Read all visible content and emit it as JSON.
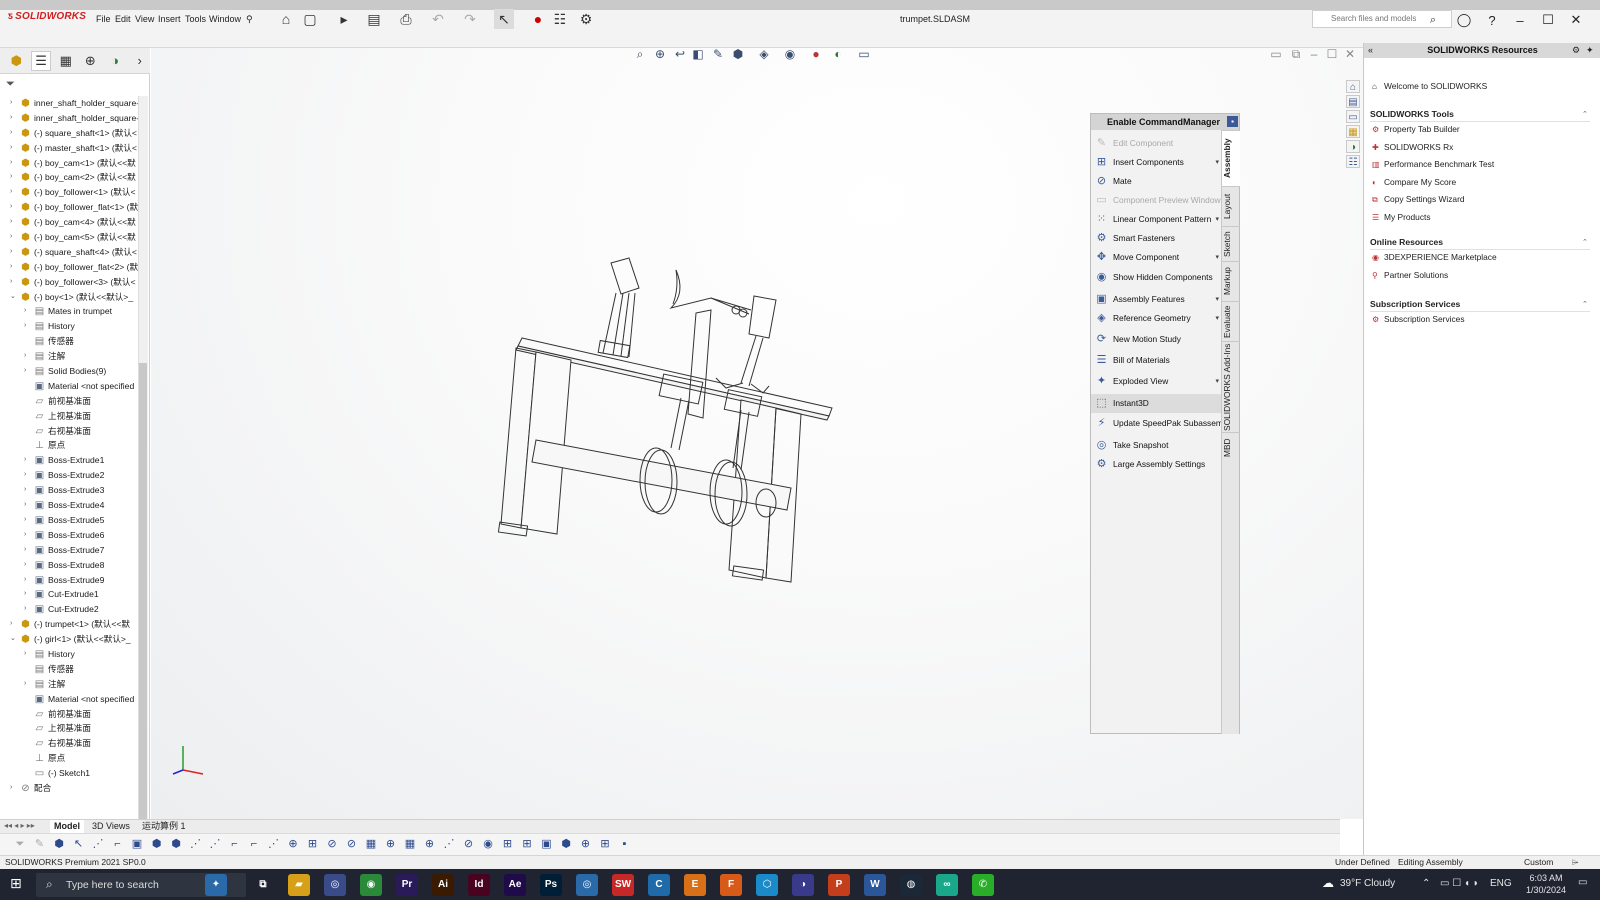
{
  "app": {
    "name": "SOLIDWORKS",
    "doc_title": "trumpet.SLDASM"
  },
  "menu": [
    "File",
    "Edit",
    "View",
    "Insert",
    "Tools",
    "Window"
  ],
  "search": {
    "placeholder": "Search files and models"
  },
  "tree": [
    {
      "depth": 0,
      "arrow": "›",
      "icon": "part",
      "label": "inner_shaft_holder_square-"
    },
    {
      "depth": 0,
      "arrow": "›",
      "icon": "part",
      "label": "inner_shaft_holder_square-"
    },
    {
      "depth": 0,
      "arrow": "›",
      "icon": "part",
      "label": "(-) square_shaft<1> (默认<"
    },
    {
      "depth": 0,
      "arrow": "›",
      "icon": "part",
      "label": "(-) master_shaft<1> (默认<"
    },
    {
      "depth": 0,
      "arrow": "›",
      "icon": "part",
      "label": "(-) boy_cam<1> (默认<<默"
    },
    {
      "depth": 0,
      "arrow": "›",
      "icon": "part",
      "label": "(-) boy_cam<2> (默认<<默"
    },
    {
      "depth": 0,
      "arrow": "›",
      "icon": "part",
      "label": "(-) boy_follower<1> (默认<"
    },
    {
      "depth": 0,
      "arrow": "›",
      "icon": "part",
      "label": "(-) boy_follower_flat<1> (默"
    },
    {
      "depth": 0,
      "arrow": "›",
      "icon": "part",
      "label": "(-) boy_cam<4> (默认<<默"
    },
    {
      "depth": 0,
      "arrow": "›",
      "icon": "part",
      "label": "(-) boy_cam<5> (默认<<默"
    },
    {
      "depth": 0,
      "arrow": "›",
      "icon": "part",
      "label": "(-) square_shaft<4> (默认<"
    },
    {
      "depth": 0,
      "arrow": "›",
      "icon": "part",
      "label": "(-) boy_follower_flat<2> (默"
    },
    {
      "depth": 0,
      "arrow": "›",
      "icon": "part",
      "label": "(-) boy_follower<3> (默认<"
    },
    {
      "depth": 0,
      "arrow": "⌄",
      "icon": "part",
      "label": "(-) boy<1> (默认<<默认>_"
    },
    {
      "depth": 1,
      "arrow": "›",
      "icon": "folder",
      "label": "Mates in trumpet"
    },
    {
      "depth": 1,
      "arrow": "›",
      "icon": "folder",
      "label": "History"
    },
    {
      "depth": 1,
      "arrow": "",
      "icon": "folder",
      "label": "传感器"
    },
    {
      "depth": 1,
      "arrow": "›",
      "icon": "folder",
      "label": "注解"
    },
    {
      "depth": 1,
      "arrow": "›",
      "icon": "folder",
      "label": "Solid Bodies(9)"
    },
    {
      "depth": 1,
      "arrow": "",
      "icon": "feat",
      "label": "Material <not specified"
    },
    {
      "depth": 1,
      "arrow": "",
      "icon": "plane",
      "label": "前视基准面"
    },
    {
      "depth": 1,
      "arrow": "",
      "icon": "plane",
      "label": "上视基准面"
    },
    {
      "depth": 1,
      "arrow": "",
      "icon": "plane",
      "label": "右视基准面"
    },
    {
      "depth": 1,
      "arrow": "",
      "icon": "origin",
      "label": "原点"
    },
    {
      "depth": 1,
      "arrow": "›",
      "icon": "feat",
      "label": "Boss-Extrude1"
    },
    {
      "depth": 1,
      "arrow": "›",
      "icon": "feat",
      "label": "Boss-Extrude2"
    },
    {
      "depth": 1,
      "arrow": "›",
      "icon": "feat",
      "label": "Boss-Extrude3"
    },
    {
      "depth": 1,
      "arrow": "›",
      "icon": "feat",
      "label": "Boss-Extrude4"
    },
    {
      "depth": 1,
      "arrow": "›",
      "icon": "feat",
      "label": "Boss-Extrude5"
    },
    {
      "depth": 1,
      "arrow": "›",
      "icon": "feat",
      "label": "Boss-Extrude6"
    },
    {
      "depth": 1,
      "arrow": "›",
      "icon": "feat",
      "label": "Boss-Extrude7"
    },
    {
      "depth": 1,
      "arrow": "›",
      "icon": "feat",
      "label": "Boss-Extrude8"
    },
    {
      "depth": 1,
      "arrow": "›",
      "icon": "feat",
      "label": "Boss-Extrude9"
    },
    {
      "depth": 1,
      "arrow": "›",
      "icon": "feat",
      "label": "Cut-Extrude1"
    },
    {
      "depth": 1,
      "arrow": "›",
      "icon": "feat",
      "label": "Cut-Extrude2"
    },
    {
      "depth": 0,
      "arrow": "›",
      "icon": "part",
      "label": "(-) trumpet<1> (默认<<默"
    },
    {
      "depth": 0,
      "arrow": "⌄",
      "icon": "part",
      "label": "(-) girl<1> (默认<<默认>_"
    },
    {
      "depth": 1,
      "arrow": "›",
      "icon": "folder",
      "label": "History"
    },
    {
      "depth": 1,
      "arrow": "",
      "icon": "folder",
      "label": "传感器"
    },
    {
      "depth": 1,
      "arrow": "›",
      "icon": "folder",
      "label": "注解"
    },
    {
      "depth": 1,
      "arrow": "",
      "icon": "feat",
      "label": "Material <not specified"
    },
    {
      "depth": 1,
      "arrow": "",
      "icon": "plane",
      "label": "前视基准面"
    },
    {
      "depth": 1,
      "arrow": "",
      "icon": "plane",
      "label": "上视基准面"
    },
    {
      "depth": 1,
      "arrow": "",
      "icon": "plane",
      "label": "右视基准面"
    },
    {
      "depth": 1,
      "arrow": "",
      "icon": "origin",
      "label": "原点"
    },
    {
      "depth": 1,
      "arrow": "",
      "icon": "sketch",
      "label": "(-) Sketch1"
    },
    {
      "depth": 0,
      "arrow": "›",
      "icon": "mates",
      "label": "配合"
    }
  ],
  "bottom_tabs": [
    "Model",
    "3D Views",
    "运动算例 1"
  ],
  "commandmanager": {
    "title": "Enable CommandManager",
    "items": [
      {
        "label": "Edit Component",
        "icon": "edit-component-icon",
        "glyph": "✎",
        "disabled": true,
        "dropdown": false
      },
      {
        "label": "Insert Components",
        "icon": "insert-components-icon",
        "glyph": "⊞",
        "disabled": false,
        "dropdown": true
      },
      {
        "label": "Mate",
        "icon": "mate-icon",
        "glyph": "⊘",
        "disabled": false,
        "dropdown": false
      },
      {
        "label": "Component Preview Window",
        "icon": "preview-window-icon",
        "glyph": "▭",
        "disabled": true,
        "dropdown": false
      },
      {
        "label": "Linear Component Pattern",
        "icon": "linear-pattern-icon",
        "glyph": "⁙",
        "disabled": false,
        "dropdown": true
      },
      {
        "label": "Smart Fasteners",
        "icon": "smart-fasteners-icon",
        "glyph": "⚙",
        "disabled": false,
        "dropdown": false
      },
      {
        "label": "Move Component",
        "icon": "move-component-icon",
        "glyph": "✥",
        "disabled": false,
        "dropdown": true
      },
      {
        "label": "Show Hidden Components",
        "icon": "show-hidden-icon",
        "glyph": "◉",
        "disabled": false,
        "dropdown": false
      },
      {
        "label": "Assembly Features",
        "icon": "assembly-features-icon",
        "glyph": "▣",
        "disabled": false,
        "dropdown": true
      },
      {
        "label": "Reference Geometry",
        "icon": "reference-geometry-icon",
        "glyph": "◈",
        "disabled": false,
        "dropdown": true
      },
      {
        "label": "New Motion Study",
        "icon": "motion-study-icon",
        "glyph": "⟳",
        "disabled": false,
        "dropdown": false
      },
      {
        "label": "Bill of Materials",
        "icon": "bom-icon",
        "glyph": "☰",
        "disabled": false,
        "dropdown": false
      },
      {
        "label": "Exploded View",
        "icon": "exploded-view-icon",
        "glyph": "✦",
        "disabled": false,
        "dropdown": true
      },
      {
        "label": "Instant3D",
        "icon": "instant3d-icon",
        "glyph": "⬚",
        "disabled": false,
        "dropdown": false,
        "highlight": true
      },
      {
        "label": "Update SpeedPak Subassem...",
        "icon": "speedpak-icon",
        "glyph": "⚡",
        "disabled": false,
        "dropdown": false
      },
      {
        "label": "Take Snapshot",
        "icon": "snapshot-icon",
        "glyph": "◎",
        "disabled": false,
        "dropdown": false
      },
      {
        "label": "Large Assembly Settings",
        "icon": "large-assembly-icon",
        "glyph": "⚙",
        "disabled": false,
        "dropdown": false
      }
    ],
    "vtabs": [
      "Assembly",
      "Layout",
      "Sketch",
      "Markup",
      "Evaluate",
      "SOLIDWORKS Add-Ins",
      "MBD"
    ]
  },
  "taskpane": {
    "title": "SOLIDWORKS Resources",
    "welcome": "Welcome to SOLIDWORKS",
    "sections": [
      {
        "title": "SOLIDWORKS Tools",
        "items": [
          "Property Tab Builder",
          "SOLIDWORKS Rx",
          "Performance Benchmark Test",
          "Compare My Score",
          "Copy Settings Wizard",
          "My Products"
        ]
      },
      {
        "title": "Online Resources",
        "items": [
          "3DEXPERIENCE Marketplace",
          "Partner Solutions"
        ]
      },
      {
        "title": "Subscription Services",
        "items": [
          "Subscription Services"
        ]
      }
    ]
  },
  "status": {
    "left": "SOLIDWORKS Premium 2021 SP0.0",
    "under_defined": "Under Defined",
    "editing": "Editing Assembly",
    "custom": "Custom"
  },
  "taskbar": {
    "search": "Type here to search",
    "weather": "39°F  Cloudy",
    "lang": "ENG",
    "time": "6:03 AM",
    "date": "1/30/2024"
  }
}
